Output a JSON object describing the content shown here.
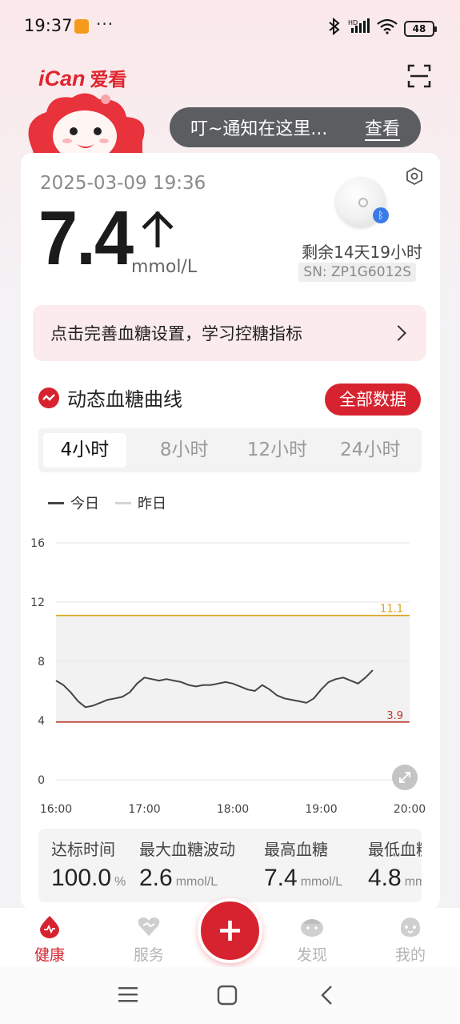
{
  "status_bar": {
    "time": "19:37",
    "dots": "···",
    "network": "HD",
    "battery": "48",
    "icons": [
      "bluetooth-icon",
      "signal-icon",
      "wifi-icon",
      "battery-icon"
    ]
  },
  "header": {
    "brand_en": "iCan",
    "brand_cn": "爱看",
    "notice_text": "叮~通知在这里...",
    "notice_action": "查看"
  },
  "reading": {
    "datetime": "2025-03-09 19:36",
    "value": "7.4",
    "unit": "mmol/L",
    "trend": "rising",
    "remaining": "剩余14天19小时",
    "serial": "SN: ZP1G6012S"
  },
  "promo": {
    "text": "点击完善血糖设置，学习控糖指标"
  },
  "curve_section": {
    "title": "动态血糖曲线",
    "all_data_label": "全部数据",
    "tabs": [
      {
        "label": "4小时",
        "active": true
      },
      {
        "label": "8小时",
        "active": false
      },
      {
        "label": "12小时",
        "active": false
      },
      {
        "label": "24小时",
        "active": false
      }
    ],
    "legend": [
      {
        "label": "今日",
        "color": "#444444"
      },
      {
        "label": "昨日",
        "color": "#d5d5d5"
      }
    ]
  },
  "chart_data": {
    "type": "line",
    "title": "",
    "xlabel": "",
    "ylabel": "",
    "ylim": [
      0,
      16
    ],
    "y_ticks": [
      "16",
      "12",
      "8",
      "4",
      "0"
    ],
    "x_ticks": [
      "16:00",
      "17:00",
      "18:00",
      "19:00",
      "20:00"
    ],
    "target_band": [
      3.9,
      11.1
    ],
    "upper_limit": {
      "value": 11.1,
      "label": "11.1",
      "color": "#d9a21b"
    },
    "lower_limit": {
      "value": 3.9,
      "label": "3.9",
      "color": "#c0392b"
    },
    "grid": true,
    "series": [
      {
        "name": "今日",
        "x": [
          "16:00",
          "16:05",
          "16:10",
          "16:15",
          "16:20",
          "16:25",
          "16:30",
          "16:35",
          "16:40",
          "16:45",
          "16:50",
          "16:55",
          "17:00",
          "17:05",
          "17:10",
          "17:15",
          "17:20",
          "17:25",
          "17:30",
          "17:35",
          "17:40",
          "17:45",
          "17:50",
          "17:55",
          "18:00",
          "18:05",
          "18:10",
          "18:15",
          "18:20",
          "18:25",
          "18:30",
          "18:35",
          "18:40",
          "18:45",
          "18:50",
          "18:55",
          "19:00",
          "19:05",
          "19:10",
          "19:15",
          "19:20",
          "19:25",
          "19:30",
          "19:35"
        ],
        "values": [
          6.7,
          6.4,
          5.9,
          5.3,
          4.9,
          5.0,
          5.2,
          5.4,
          5.5,
          5.6,
          5.9,
          6.5,
          6.9,
          6.8,
          6.7,
          6.8,
          6.7,
          6.6,
          6.4,
          6.3,
          6.4,
          6.4,
          6.5,
          6.6,
          6.5,
          6.3,
          6.1,
          6.0,
          6.4,
          6.1,
          5.7,
          5.5,
          5.4,
          5.3,
          5.2,
          5.5,
          6.1,
          6.6,
          6.8,
          6.9,
          6.7,
          6.5,
          6.9,
          7.4
        ]
      }
    ]
  },
  "stats": [
    {
      "label": "达标时间",
      "value": "100.0",
      "unit": "%"
    },
    {
      "label": "最大血糖波动",
      "value": "2.6",
      "unit": "mmol/L"
    },
    {
      "label": "最高血糖",
      "value": "7.4",
      "unit": "mmol/L"
    },
    {
      "label": "最低血糖",
      "value": "4.8",
      "unit": "mmol/L"
    }
  ],
  "bottom_nav": [
    {
      "label": "健康",
      "icon": "health-drop-icon",
      "active": true
    },
    {
      "label": "服务",
      "icon": "service-heart-icon",
      "active": false
    },
    {
      "label": "发现",
      "icon": "discover-mascot-icon",
      "active": false
    },
    {
      "label": "我的",
      "icon": "profile-mascot-icon",
      "active": false
    }
  ],
  "fab": {
    "label": "+"
  },
  "colors": {
    "brand_red": "#d7232f",
    "text_dark": "#1b1b1b",
    "muted": "#8a8a8a"
  }
}
